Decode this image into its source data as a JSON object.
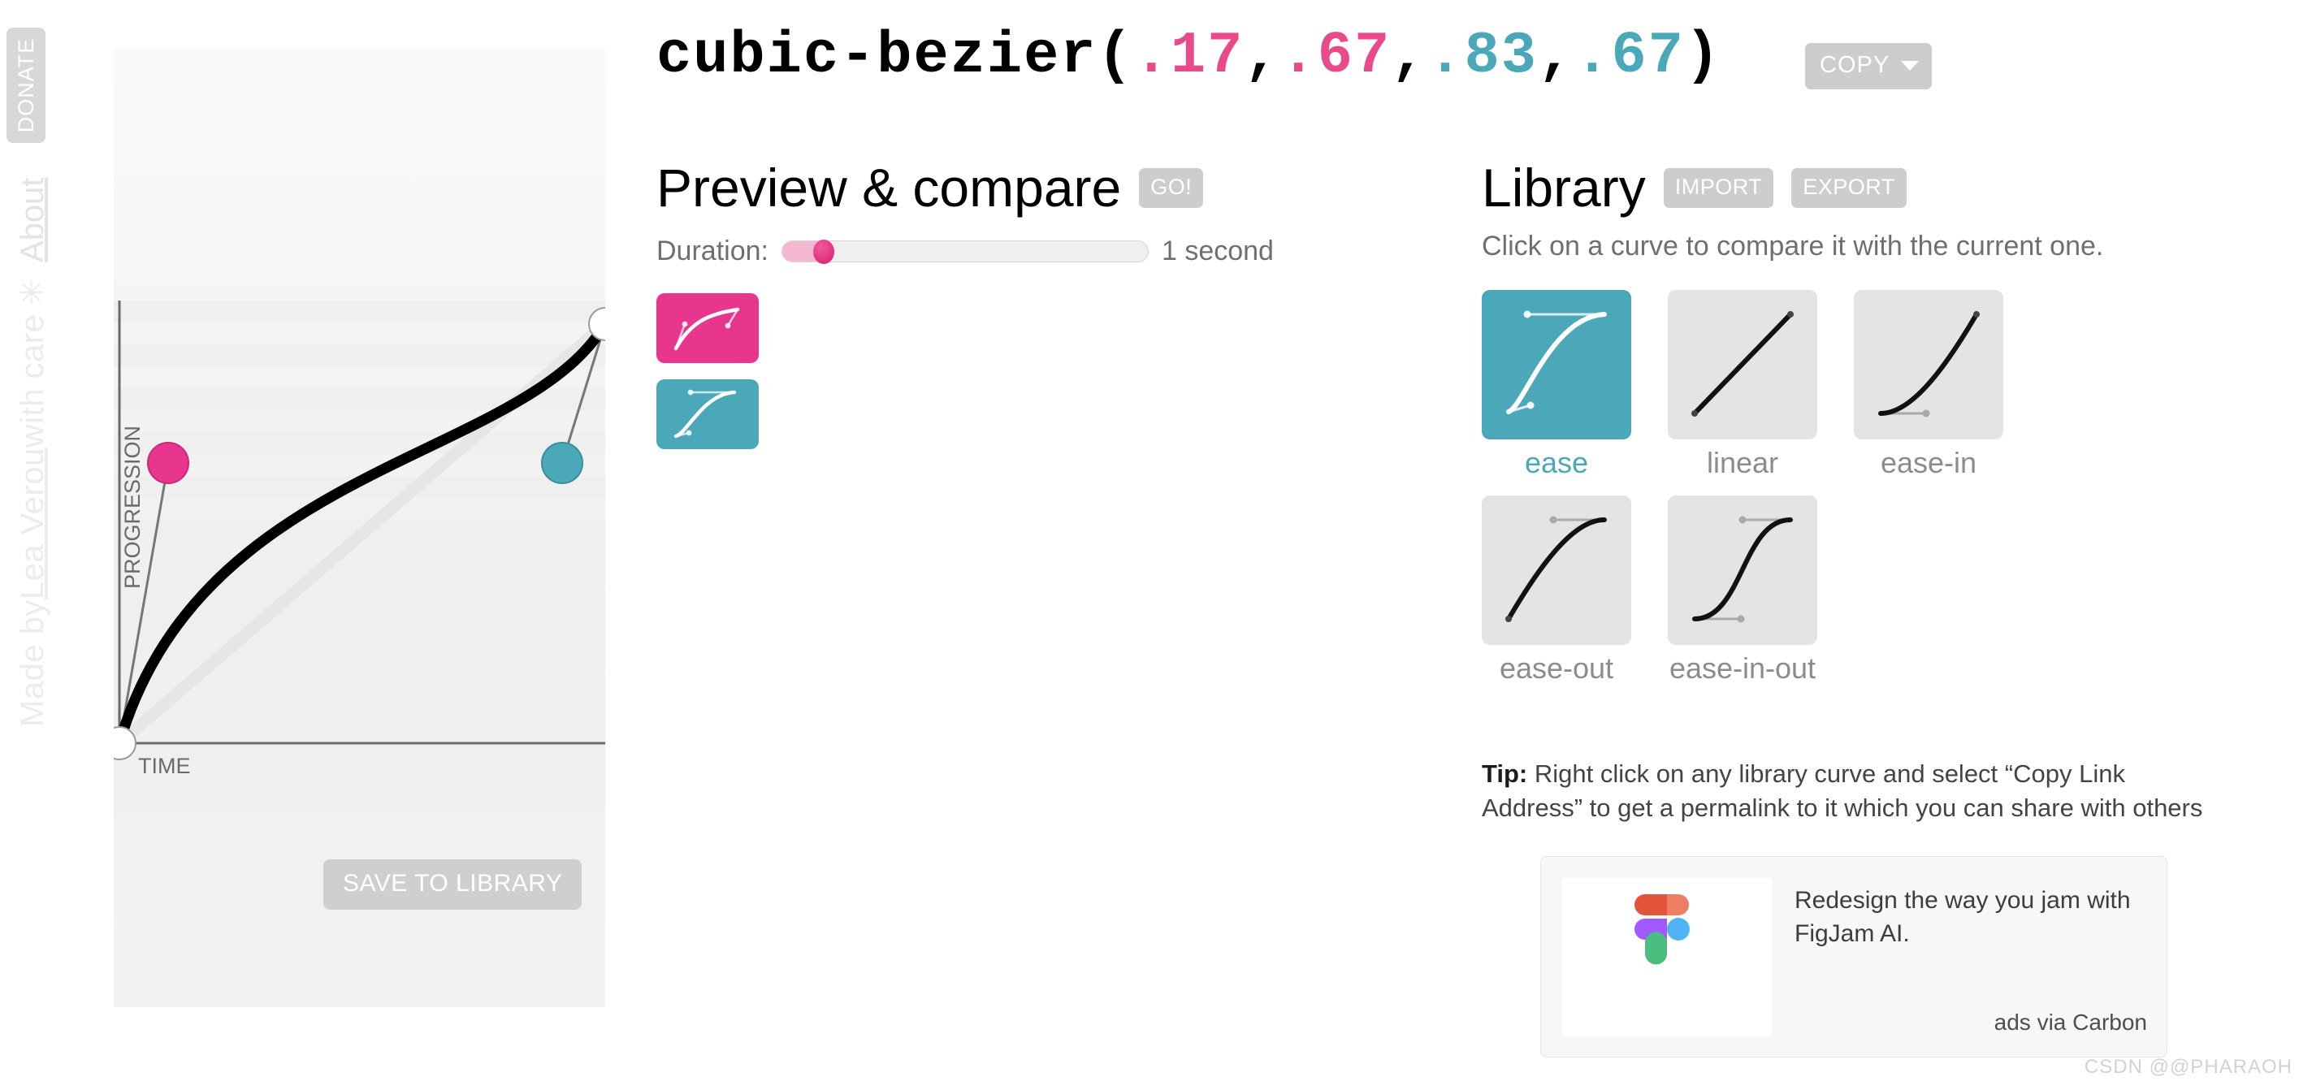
{
  "sidebar": {
    "donate_label": "DONATE",
    "credit_prefix": "Made by ",
    "credit_name": "Lea Verou",
    "credit_suffix": " with care",
    "star_glyph": "✳",
    "about_label": "About"
  },
  "header": {
    "func_name": "cubic-bezier(",
    "x1": ".17",
    "comma1": ",",
    "y1": ".67",
    "comma2": ",",
    "x2": ".83",
    "comma3": ",",
    "y2": ".67",
    "close_paren": ")",
    "copy_label": "COPY"
  },
  "editor": {
    "x_axis_label": "TIME",
    "y_axis_label": "PROGRESSION",
    "save_label": "SAVE TO LIBRARY",
    "handle1_color": "#e8368f",
    "handle2_color": "#4aa8b8"
  },
  "preview": {
    "title": "Preview & compare",
    "go_label": "GO!",
    "duration_label": "Duration:",
    "duration_value": "1 second",
    "duration_percent": "10",
    "swatch_current_color": "#e8368f",
    "swatch_compare_color": "#4aa8b8"
  },
  "library": {
    "title": "Library",
    "import_label": "IMPORT",
    "export_label": "EXPORT",
    "subtitle": "Click on a curve to compare it with the current one.",
    "items": [
      {
        "label": "ease",
        "selected": true
      },
      {
        "label": "linear",
        "selected": false
      },
      {
        "label": "ease-in",
        "selected": false
      },
      {
        "label": "ease-out",
        "selected": false
      },
      {
        "label": "ease-in-out",
        "selected": false
      }
    ],
    "tip_bold": "Tip:",
    "tip_text": " Right click on any library curve and select “Copy Link Address” to get a permalink to it which you can share with others"
  },
  "ad": {
    "text": "Redesign the way you jam with FigJam AI.",
    "credit": "ads via Carbon"
  },
  "watermark": "CSDN @@PHARAOH",
  "chart_data": {
    "type": "line",
    "title": "cubic-bezier(.17,.67,.83,.67)",
    "xlabel": "TIME",
    "ylabel": "PROGRESSION",
    "xlim": [
      0,
      1
    ],
    "ylim": [
      0,
      1
    ],
    "grid": true,
    "control_points": {
      "p0": [
        0,
        0
      ],
      "p1": [
        0.17,
        0.67
      ],
      "p2": [
        0.83,
        0.67
      ],
      "p3": [
        1,
        1
      ]
    },
    "series": [
      {
        "name": "current curve",
        "color": "#000000",
        "bezier": [
          0.17,
          0.67,
          0.83,
          0.67
        ]
      },
      {
        "name": "linear reference",
        "color": "#e4e4e4",
        "bezier": [
          0,
          0,
          1,
          1
        ]
      }
    ]
  }
}
